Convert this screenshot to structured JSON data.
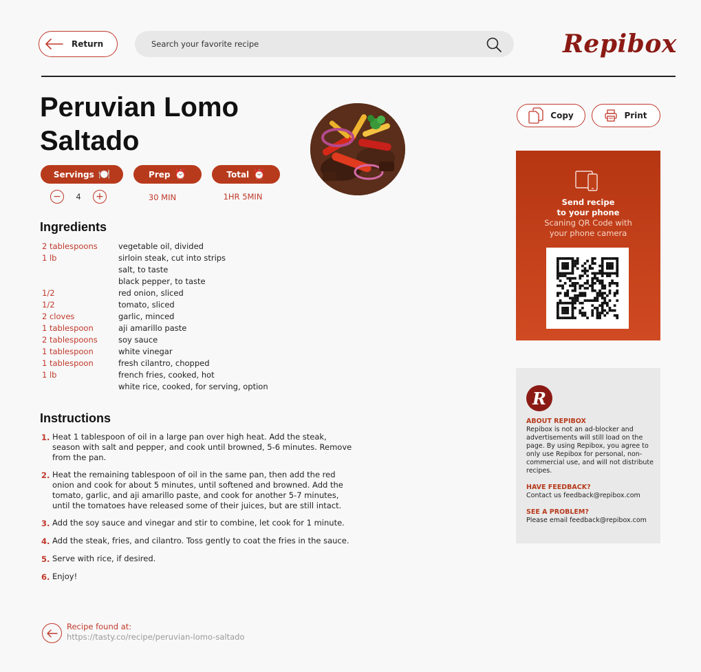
{
  "header": {
    "return_label": "Return",
    "search_placeholder": "Search your favorite recipe",
    "logo_text": "Repibox"
  },
  "recipe": {
    "title": "Peruvian Lomo Saltado",
    "servings": {
      "label": "Servings",
      "icon": "plate-icon",
      "value": "4",
      "minus": "−",
      "plus": "+"
    },
    "prep": {
      "label": "Prep",
      "icon": "alarm-clock-icon",
      "value": "30 MIN"
    },
    "total": {
      "label": "Total",
      "icon": "alarm-clock-icon",
      "value": "1HR 5MIN"
    }
  },
  "ingredients": {
    "heading": "Ingredients",
    "items": [
      {
        "qty": "2 tablespoons",
        "name": "vegetable oil, divided"
      },
      {
        "qty": "1 lb",
        "name": "sirloin steak, cut into strips"
      },
      {
        "qty": "",
        "name": "salt, to taste"
      },
      {
        "qty": "",
        "name": "black pepper, to taste"
      },
      {
        "qty": "1/2",
        "name": "red onion, sliced"
      },
      {
        "qty": "1/2",
        "name": "tomato, sliced"
      },
      {
        "qty": "2 cloves",
        "name": "garlic, minced"
      },
      {
        "qty": "1 tablespoon",
        "name": "aji amarillo paste"
      },
      {
        "qty": "2 tablespoons",
        "name": "soy sauce"
      },
      {
        "qty": "1 tablespoon",
        "name": "white vinegar"
      },
      {
        "qty": "1 tablespoon",
        "name": "fresh cilantro, chopped"
      },
      {
        "qty": "1 lb",
        "name": "french fries, cooked, hot"
      },
      {
        "qty": "",
        "name": "white rice, cooked, for serving, option"
      }
    ]
  },
  "instructions": {
    "heading": "Instructions",
    "steps": [
      {
        "num": "1.",
        "text": "Heat 1 tablespoon of oil in a large pan over high heat. Add the steak, season with salt and pepper, and cook until browned, 5-6 minutes. Remove from the pan."
      },
      {
        "num": "2.",
        "text": "Heat the remaining tablespoon of oil in the same pan, then add the red onion and cook for about 5 minutes, until softened and browned. Add the tomato, garlic, and aji amarillo paste, and cook for another 5-7 minutes, until the tomatoes have released some of their juices, but are still intact."
      },
      {
        "num": "3.",
        "text": "Add the soy sauce and vinegar and stir to combine, let cook for 1 minute."
      },
      {
        "num": "4.",
        "text": "Add the steak, fries, and cilantro. Toss gently to coat the fries in the sauce."
      },
      {
        "num": "5.",
        "text": "Serve with rice, if desired."
      },
      {
        "num": "6.",
        "text": "Enjoy!"
      }
    ]
  },
  "source": {
    "label": "Recipe found at:",
    "url": "https://tasty.co/recipe/peruvian-lomo-saltado"
  },
  "actions": {
    "copy_label": "Copy",
    "print_label": "Print"
  },
  "qr_card": {
    "title_line1": "Send recipe",
    "title_line2": "to your phone",
    "subtitle_line1": "Scaning QR Code with",
    "subtitle_line2": "your phone camera"
  },
  "about": {
    "badge": "R",
    "about_heading": "ABOUT REPIBOX",
    "about_text": "Repibox is not an ad-blocker and advertisements will still load on the page. By using Repibox, you agree to only use Repibox for personal, non-commercial use, and will not distribute recipes.",
    "feedback_heading": "HAVE FEEDBACK?",
    "feedback_text": "Contact us feedback@repibox.com",
    "problem_heading": "SEE A PROBLEM?",
    "problem_text": "Please email feedback@repibox.com"
  },
  "colors": {
    "accent": "#c0392b",
    "brand": "#8b1a14",
    "pill": "#b83a1c"
  }
}
